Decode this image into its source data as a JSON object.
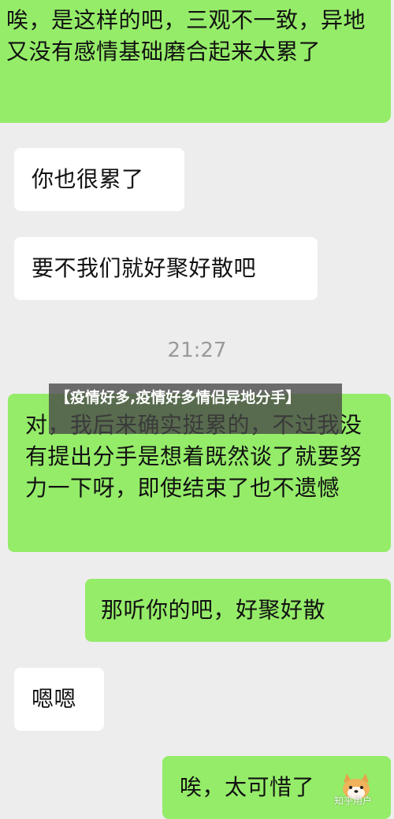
{
  "messages": [
    {
      "side": "right",
      "text": "唉，是这样的吧，三观不一致，异地又没有感情基础磨合起来太累了"
    },
    {
      "side": "left",
      "text": "你也很累了"
    },
    {
      "side": "left",
      "text": "要不我们就好聚好散吧"
    },
    {
      "side": "left",
      "text": "对，我后来确实挺累的，不过我没有提出分手是想着既然谈了就要努力一下呀，即使结束了也不遗憾"
    },
    {
      "side": "right",
      "text": "那听你的吧，好聚好散"
    },
    {
      "side": "left",
      "text": "嗯嗯"
    },
    {
      "side": "right",
      "text": "唉，太可惜了"
    }
  ],
  "timestamp": "21:27",
  "overlay_title": "【疫情好多,疫情好多情侣异地分手】",
  "watermark": "知乎用户",
  "colors": {
    "background": "#ededed",
    "mine_bubble": "#95ec69",
    "theirs_bubble": "#ffffff",
    "timestamp": "#9a9a9a"
  }
}
